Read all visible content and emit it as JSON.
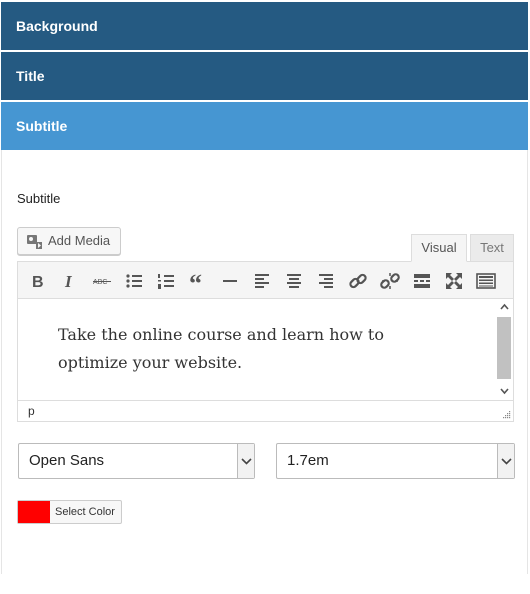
{
  "accordion": {
    "background": "Background",
    "title": "Title",
    "subtitle": "Subtitle"
  },
  "field": {
    "label": "Subtitle"
  },
  "editor": {
    "add_media": "Add Media",
    "tabs": {
      "visual": "Visual",
      "text": "Text"
    },
    "content": "Take the online course and learn how to optimize your website.",
    "status_path": "p",
    "toolbar": [
      "bold",
      "italic",
      "strikethrough",
      "bulleted-list",
      "numbered-list",
      "blockquote",
      "horizontal-line",
      "align-left",
      "align-center",
      "align-right",
      "insert-link",
      "remove-link",
      "read-more",
      "fullscreen",
      "toolbar-toggle"
    ]
  },
  "font": {
    "family": "Open Sans",
    "line_height": "1.7em"
  },
  "color_picker": {
    "label": "Select Color",
    "value": "#ff0000"
  },
  "colors": {
    "header": "#255a82",
    "header_active": "#4696d2"
  }
}
